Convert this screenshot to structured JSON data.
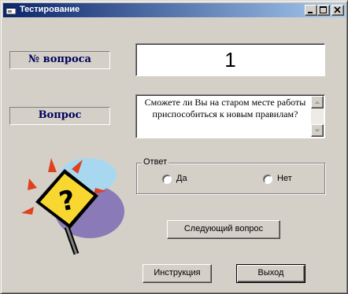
{
  "window": {
    "title": "Тестирование",
    "controls": {
      "minimize": "minimize",
      "maximize": "maximize",
      "close": "close"
    }
  },
  "labels": {
    "question_number": "№ вопроса",
    "question": "Вопрос"
  },
  "question_number_value": "1",
  "question_text": "Сможете ли Вы на старом месте работы приспособиться к новым правилам?",
  "answer_group": {
    "legend": "Ответ",
    "options": [
      {
        "label": "Да",
        "selected": false
      },
      {
        "label": "Нет",
        "selected": false
      }
    ]
  },
  "buttons": {
    "next_question": "Следующий вопрос",
    "instruction": "Инструкция",
    "exit": "Выход"
  },
  "icons": {
    "app": "app-window-icon",
    "clipart": "question-sign-icon"
  },
  "colors": {
    "title_gradient_start": "#0a246a",
    "title_gradient_end": "#a6caf0",
    "label_text": "#00005c",
    "face": "#d4d0c8"
  }
}
